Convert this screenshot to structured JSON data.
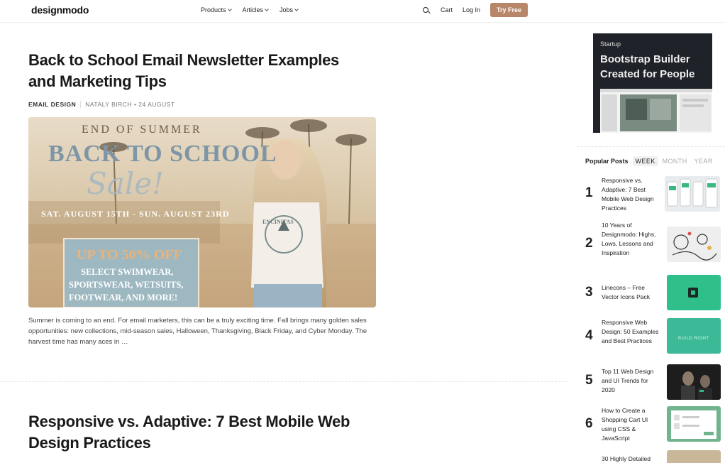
{
  "header": {
    "logo": "designmodo",
    "nav": [
      {
        "label": "Products"
      },
      {
        "label": "Articles"
      },
      {
        "label": "Jobs"
      }
    ],
    "cart_label": "Cart",
    "login_label": "Log In",
    "cta_label": "Try Free"
  },
  "article1": {
    "title_line1": "Back to School Email Newsletter Examples",
    "title_line2": "and Marketing Tips",
    "category": "EMAIL DESIGN",
    "byline": "NATALY BIRCH • 24 AUGUST",
    "image_text": {
      "top": "END OF SUMMER",
      "big": "BACK TO SCHOOL",
      "script": "Sale!",
      "dates": "SAT. AUGUST 15TH - SUN. AUGUST 23RD",
      "offer": "UP TO 50% OFF",
      "offer_detail_1": "SELECT SWIMWEAR,",
      "offer_detail_2": "SPORTSWEAR, WETSUITS,",
      "offer_detail_3": "FOOTWEAR, AND MORE!",
      "shirt": "ENCINITAS"
    },
    "excerpt": "Summer is coming to an end. For email marketers, this can be a truly exciting time. Fall brings many golden sales opportunities: new collections, mid-season sales, Halloween, Thanksgiving, Black Friday, and Cyber Monday. The harvest time has many aces in …"
  },
  "article2": {
    "title_line1": "Responsive vs. Adaptive: 7 Best Mobile Web",
    "title_line2": "Design Practices"
  },
  "ad": {
    "kicker": "Startup",
    "title": "Bootstrap Builder Created for People"
  },
  "popular": {
    "label": "Popular Posts",
    "tabs": [
      "WEEK",
      "MONTH",
      "YEAR"
    ],
    "active_tab": "WEEK",
    "items": [
      {
        "num": "1",
        "title": "Responsive vs. Adaptive: 7 Best Mobile Web Design Practices",
        "thumb_color": "#e9ecef"
      },
      {
        "num": "2",
        "title": "10 Years of Designmodo: Highs, Lows, Lessons and Inspiration",
        "thumb_color": "#eeeeee"
      },
      {
        "num": "3",
        "title": "Linecons – Free Vector Icons Pack",
        "thumb_color": "#2fbf8a"
      },
      {
        "num": "4",
        "title": "Responsive Web Design: 50 Examples and Best Practices",
        "thumb_color": "#3cb997"
      },
      {
        "num": "5",
        "title": "Top 11 Web Design and UI Trends for 2020",
        "thumb_color": "#1d1d1d"
      },
      {
        "num": "6",
        "title": "How to Create a Shopping Cart UI using CSS & JavaScript",
        "thumb_color": "#6fb48d"
      },
      {
        "num": "7",
        "title": "30 Highly Detailed",
        "thumb_color": "#c9b79a"
      }
    ]
  }
}
